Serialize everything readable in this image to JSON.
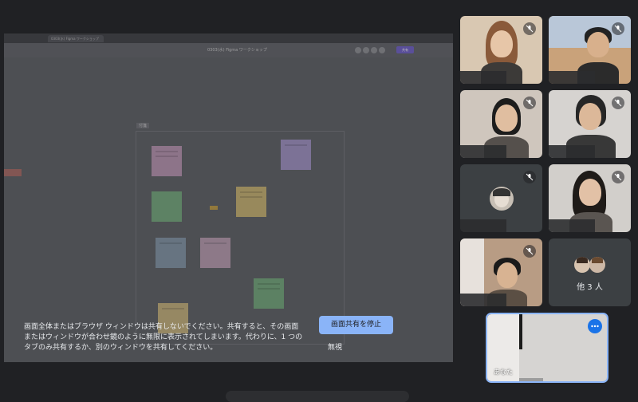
{
  "shared_screen": {
    "browser_tab_title": "0303(水) Figma ワークショップ",
    "doc_title": "0303(水) Figma ワークショップ",
    "share_button": "共有",
    "frame_label": "付箋"
  },
  "share_warning": {
    "message": "画面全体またはブラウザ ウィンドウは共有しないでください。共有すると、その画面\nまたはウィンドウが合わせ鏡のように無限に表示されてしまいます。代わりに、1 つの\nタブのみ共有するか、別のウィンドウを共有してください。",
    "stop_button": "画面共有を停止",
    "ignore_button": "無視"
  },
  "participants": {
    "others_label": "他 3 人",
    "self_name": "あなた"
  },
  "colors": {
    "accent": "#8ab4f8",
    "background": "#202124",
    "tile": "#3c4043"
  }
}
